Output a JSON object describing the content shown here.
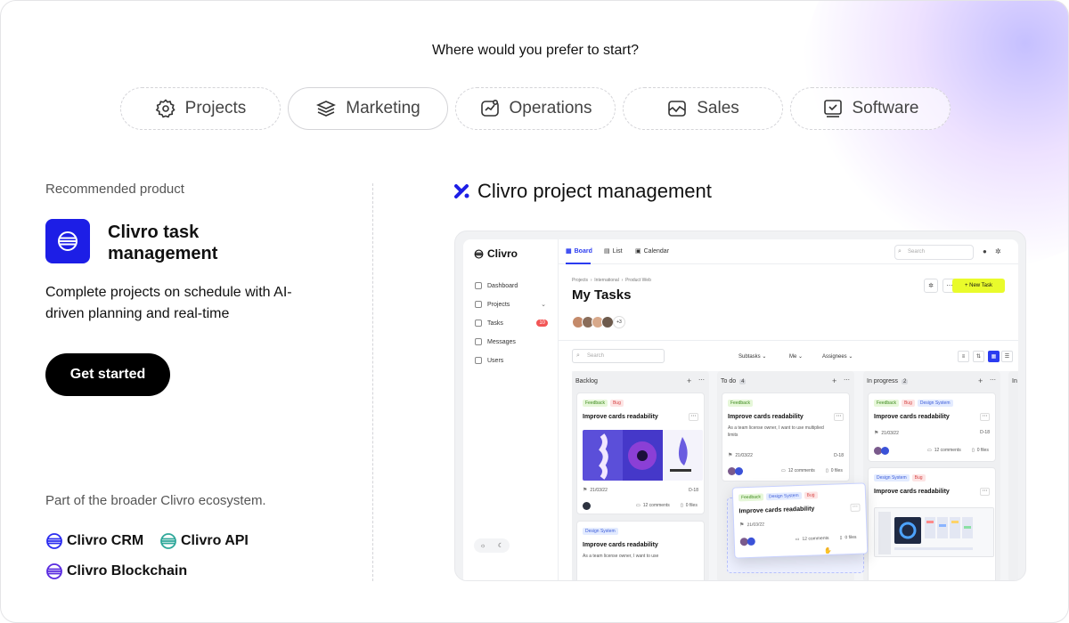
{
  "question": "Where would you prefer to start?",
  "categories": [
    {
      "label": "Projects",
      "icon": "gear-icon"
    },
    {
      "label": "Marketing",
      "icon": "layers-icon"
    },
    {
      "label": "Operations",
      "icon": "chart-box-icon"
    },
    {
      "label": "Sales",
      "icon": "sales-chart-icon"
    },
    {
      "label": "Software",
      "icon": "code-window-icon"
    }
  ],
  "recommended": {
    "label": "Recommended product",
    "name": "Clivro task management",
    "description": "Complete projects on schedule with AI-driven  planning and real-time",
    "cta": "Get started"
  },
  "ecosystem": {
    "label": "Part of the broader Clivro ecosystem.",
    "items": [
      "Clivro CRM",
      "Clivro API",
      "Clivro Blockchain"
    ]
  },
  "preview": {
    "title": "Clivro project management"
  },
  "app": {
    "logo": "Clivro",
    "nav": [
      "Dashboard",
      "Projects",
      "Tasks",
      "Messages",
      "Users"
    ],
    "tasks_badge": "10",
    "tabs": [
      "Board",
      "List",
      "Calendar"
    ],
    "search_placeholder": "Search",
    "breadcrumb": [
      "Projects",
      "International",
      "Product Web"
    ],
    "page_title": "My Tasks",
    "avatars_more": "+3",
    "new_task": "+ New Task",
    "filter_search_placeholder": "Search",
    "filters": [
      "Subtasks",
      "Me",
      "Assignees"
    ],
    "columns": [
      {
        "name": "Backlog",
        "count": ""
      },
      {
        "name": "To do",
        "count": "4"
      },
      {
        "name": "In progress",
        "count": "2"
      },
      {
        "name": "In",
        "count": ""
      }
    ],
    "cards": {
      "backlog_1": {
        "tags": [
          "Feedback",
          "Bug"
        ],
        "title": "Improve cards readability",
        "date": "21/03/22",
        "due": "D-18",
        "comments": "12 comments",
        "files": "0 files"
      },
      "backlog_2": {
        "tags": [
          "Design System"
        ],
        "title": "Improve cards readability",
        "desc": "As a team license owner, I want to use"
      },
      "todo_1": {
        "tags": [
          "Feedback"
        ],
        "title": "Improve cards readability",
        "desc": "As a team license owner, I want to use multiplied limits",
        "date": "21/03/22",
        "due": "D-18",
        "comments": "12 comments",
        "files": "0 files"
      },
      "progress_1": {
        "tags": [
          "Feedback",
          "Bug",
          "Design System"
        ],
        "title": "Improve cards readability",
        "date": "21/03/22",
        "due": "D-18",
        "comments": "12 comments",
        "files": "0 files"
      },
      "progress_2": {
        "tags": [
          "Design System",
          "Bug"
        ],
        "title": "Improve cards readability"
      },
      "dragging": {
        "tags": [
          "Feedback",
          "Design System",
          "Bug"
        ],
        "title": "Improve cards readability",
        "date": "21/03/22",
        "comments": "12 comments",
        "files": "0 files"
      }
    }
  },
  "colors": {
    "brand_blue": "#1d1ee6",
    "accent_yellow": "#e9fb2b",
    "primary_text": "#111111"
  }
}
